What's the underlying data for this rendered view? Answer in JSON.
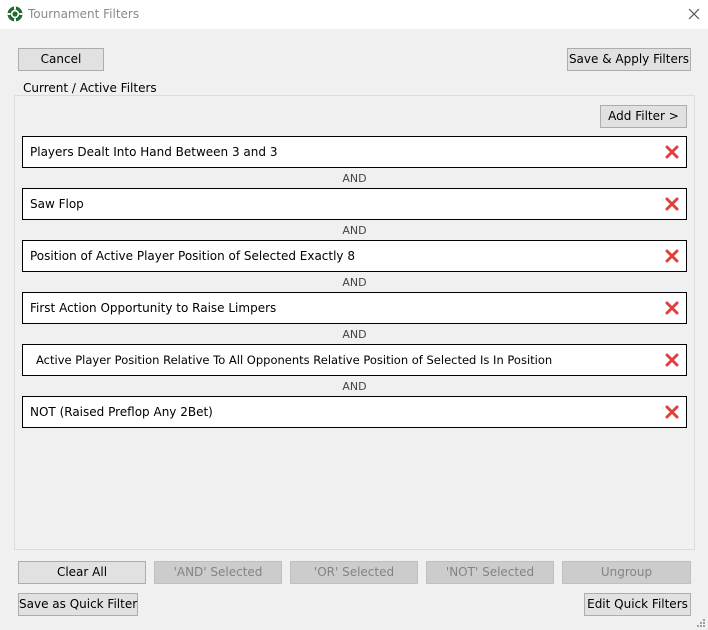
{
  "window": {
    "title": "Tournament Filters"
  },
  "toolbar": {
    "cancel_label": "Cancel",
    "save_apply_label": "Save & Apply Filters"
  },
  "group": {
    "label": "Current / Active Filters",
    "add_filter_label": "Add Filter >"
  },
  "filters": [
    {
      "text": "Players Dealt Into Hand Between 3 and 3"
    },
    {
      "text": "Saw Flop"
    },
    {
      "text": "Position of Active Player Position of Selected Exactly 8"
    },
    {
      "text": "First Action Opportunity to Raise Limpers"
    },
    {
      "text": "Active Player Position Relative To All Opponents Relative Position of Selected Is In Position"
    },
    {
      "text": "NOT (Raised Preflop Any 2Bet)"
    }
  ],
  "connectors": [
    "AND",
    "AND",
    "AND",
    "AND",
    "AND"
  ],
  "bottom": {
    "clear_all": "Clear All",
    "and_selected": "'AND' Selected",
    "or_selected": "'OR' Selected",
    "not_selected": "'NOT' Selected",
    "ungroup": "Ungroup",
    "save_quick": "Save as Quick Filter",
    "edit_quick": "Edit Quick Filters"
  },
  "icons": {
    "app": "poker-chip-icon",
    "close": "close-icon",
    "remove": "remove-filter-icon",
    "grip": "resize-grip-icon"
  },
  "colors": {
    "remove_icon": "#e04040",
    "disabled_text": "#838383"
  }
}
